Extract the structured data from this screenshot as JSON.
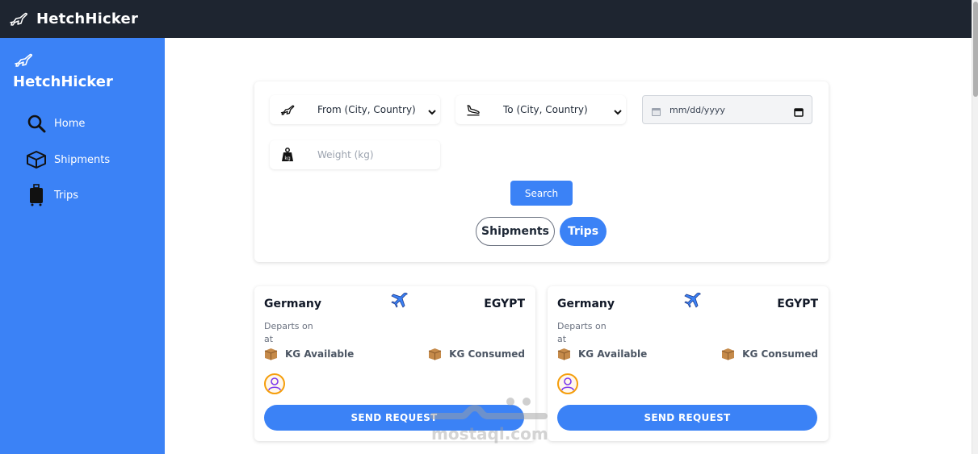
{
  "app": {
    "title": "HetchHicker"
  },
  "sidebar": {
    "logo_text": "HetchHicker",
    "items": [
      {
        "label": "Home",
        "icon": "search-icon"
      },
      {
        "label": "Shipments",
        "icon": "box-icon"
      },
      {
        "label": "Trips",
        "icon": "suitcase-icon"
      }
    ]
  },
  "search": {
    "from_value": "From (City, Country)",
    "to_value": "To (City, Country)",
    "date_placeholder": "mm/dd/yyyy",
    "weight_placeholder": "Weight (kg)",
    "button_label": "Search"
  },
  "tabs": {
    "shipments_label": "Shipments",
    "trips_label": "Trips",
    "active": "Trips"
  },
  "trips": [
    {
      "from": "Germany",
      "to": "EGYPT",
      "departs_label": "Departs on",
      "at_label": "at",
      "kg_available": "KG Available",
      "kg_consumed": "KG Consumed",
      "button_label": "SEND REQUEST"
    },
    {
      "from": "Germany",
      "to": "EGYPT",
      "departs_label": "Departs on",
      "at_label": "at",
      "kg_available": "KG Available",
      "kg_consumed": "KG Consumed",
      "button_label": "SEND REQUEST"
    }
  ],
  "watermark": {
    "text": "mostaql.com"
  },
  "colors": {
    "topbar": "#1e2530",
    "sidebar": "#3b82f6",
    "accent": "#3b82f6"
  }
}
